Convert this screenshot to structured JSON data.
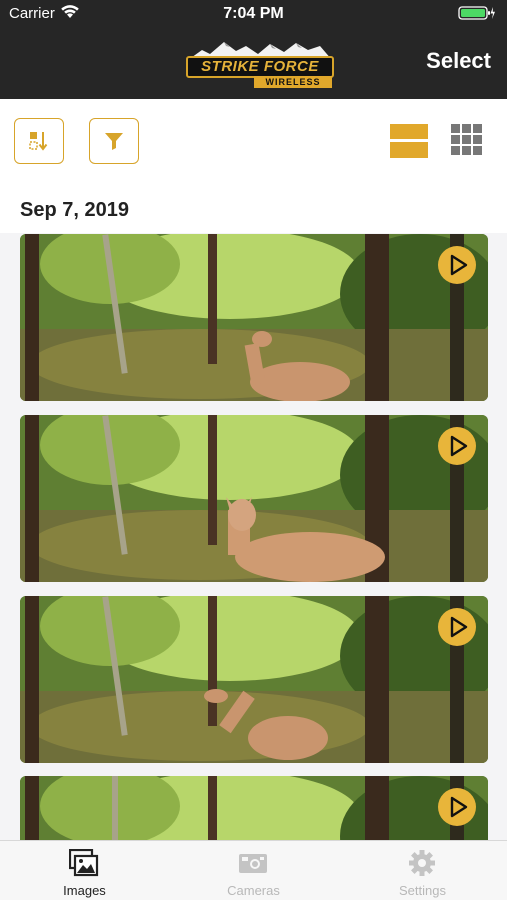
{
  "status_bar": {
    "carrier": "Carrier",
    "time": "7:04 PM"
  },
  "header": {
    "logo_text": "STRIKE FORCE",
    "logo_subtext": "WIRELESS",
    "select_label": "Select"
  },
  "toolbar": {
    "sort_icon": "sort-icon",
    "filter_icon": "filter-icon",
    "list_view_icon": "list-view-icon",
    "grid_view_icon": "grid-view-icon"
  },
  "date_section": {
    "label": "Sep 7, 2019"
  },
  "images": [
    {
      "type": "video",
      "deer_pose": "grazing-right"
    },
    {
      "type": "video",
      "deer_pose": "looking-camera"
    },
    {
      "type": "video",
      "deer_pose": "grazing-left"
    },
    {
      "type": "video",
      "deer_pose": "none"
    }
  ],
  "tabs": [
    {
      "label": "Images",
      "icon": "images-icon",
      "active": true
    },
    {
      "label": "Cameras",
      "icon": "camera-icon",
      "active": false
    },
    {
      "label": "Settings",
      "icon": "gear-icon",
      "active": false
    }
  ],
  "colors": {
    "accent": "#e1a82b",
    "header_bg": "#262626",
    "battery": "#4cd964"
  }
}
